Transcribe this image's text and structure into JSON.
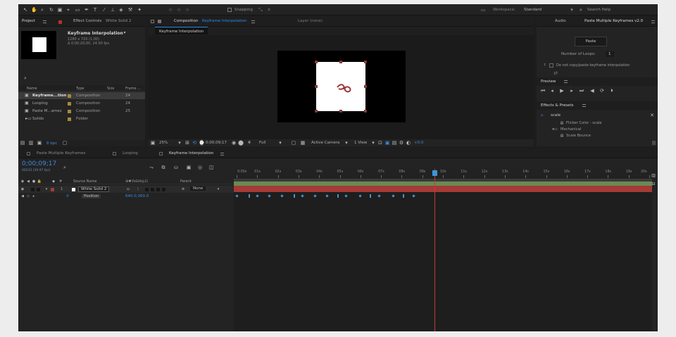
{
  "toolbar": {
    "snapping_label": "Snapping",
    "workspace_label": "Workspace:",
    "workspace_value": "Standard",
    "search_help_placeholder": "Search Help"
  },
  "project_panel": {
    "tab_label": "Project",
    "effect_controls_label": "Effect Controls",
    "effect_controls_layer": "White Solid 2",
    "comp_name": "Keyframe Interpolation",
    "comp_info_1": "1280 x 720 (1.00)",
    "comp_info_2": "Δ 0;00;20;00, 24.00 fps",
    "columns": [
      "Name",
      "Type",
      "Size",
      "Frame ..."
    ],
    "items": [
      {
        "name": "Keyframe...tion",
        "type": "Composition",
        "frame": "24",
        "color": "#a48a3d",
        "selected": true
      },
      {
        "name": "Looping",
        "type": "Composition",
        "frame": "24",
        "color": "#a48a3d",
        "selected": false
      },
      {
        "name": "Paste M...ames",
        "type": "Composition",
        "frame": "25",
        "color": "#a48a3d",
        "selected": false
      },
      {
        "name": "Solids",
        "type": "Folder",
        "frame": "",
        "color": "#a48a3d",
        "selected": false
      }
    ],
    "bpc_label": "8 bpc"
  },
  "comp_panel": {
    "tab_label": "Composition",
    "tab_comp_name": "Keyframe Interpolation",
    "layer_tab_label": "Layer (none)",
    "sub_tab": "Keyframe Interpolation",
    "zoom": "25%",
    "timecode": "0;00;09;17",
    "resolution": "Full",
    "camera": "Active Camera",
    "view": "1 View",
    "exposure": "+0.0"
  },
  "right_panel": {
    "tab_blank": "",
    "audio_tab": "Audio",
    "script_tab": "Paste Multiple Keyframes v2.0",
    "paste_button": "Paste",
    "loops_label": "Number of Loops:",
    "loops_value": "1",
    "help_label": "?",
    "checkbox_label": "Do not copy/paste keyframe interpolation",
    "preview_label": "Preview",
    "effects_label": "Effects & Presets",
    "effects_search": "scale",
    "effects_items": [
      {
        "label": "Flicker Color - scale",
        "indent": 2
      },
      {
        "label": "Mechanical",
        "indent": 1
      },
      {
        "label": "Scale Bounce",
        "indent": 2
      }
    ]
  },
  "timeline": {
    "tabs": [
      {
        "label": "Paste Multiple Keyframes",
        "active": false
      },
      {
        "label": "Looping",
        "active": false
      },
      {
        "label": "Keyframe Interpolation",
        "active": true
      }
    ],
    "timecode": "0;00;09;17",
    "timecode_sub": "00233 (29.97 fps)",
    "col_source_name": "Source Name",
    "col_parent": "Parent",
    "layer_number": "1",
    "layer_name": "White Solid 2",
    "layer_parent": "None",
    "property_name": "Position",
    "property_value": "640.0,360.0",
    "ruler_labels": [
      "0:00s",
      "01s",
      "02s",
      "03s",
      "04s",
      "05s",
      "06s",
      "07s",
      "08s",
      "09s",
      "10s",
      "11s",
      "12s",
      "13s",
      "14s",
      "15s",
      "16s",
      "17s",
      "18s",
      "19s",
      "20s"
    ],
    "playhead_time": 9.6,
    "duration": 20,
    "keyframes": [
      {
        "t": 0.0,
        "kind": "diamond"
      },
      {
        "t": 0.6,
        "kind": "bar"
      },
      {
        "t": 1.0,
        "kind": "diamond"
      },
      {
        "t": 1.6,
        "kind": "diamond"
      },
      {
        "t": 2.2,
        "kind": "diamond"
      },
      {
        "t": 2.8,
        "kind": "bar"
      },
      {
        "t": 3.2,
        "kind": "diamond"
      },
      {
        "t": 3.8,
        "kind": "diamond"
      },
      {
        "t": 4.4,
        "kind": "diamond"
      },
      {
        "t": 4.9,
        "kind": "bar"
      },
      {
        "t": 5.3,
        "kind": "diamond"
      },
      {
        "t": 6.0,
        "kind": "diamond"
      },
      {
        "t": 6.5,
        "kind": "bar"
      },
      {
        "t": 6.9,
        "kind": "diamond"
      },
      {
        "t": 7.6,
        "kind": "diamond"
      },
      {
        "t": 8.1,
        "kind": "bar"
      },
      {
        "t": 8.6,
        "kind": "diamond"
      }
    ],
    "colors": {
      "bar_green": "#6a8a52",
      "bar_red": "#a53a37",
      "playhead": "#c23b3b",
      "keyframe": "#3a97d6"
    }
  }
}
